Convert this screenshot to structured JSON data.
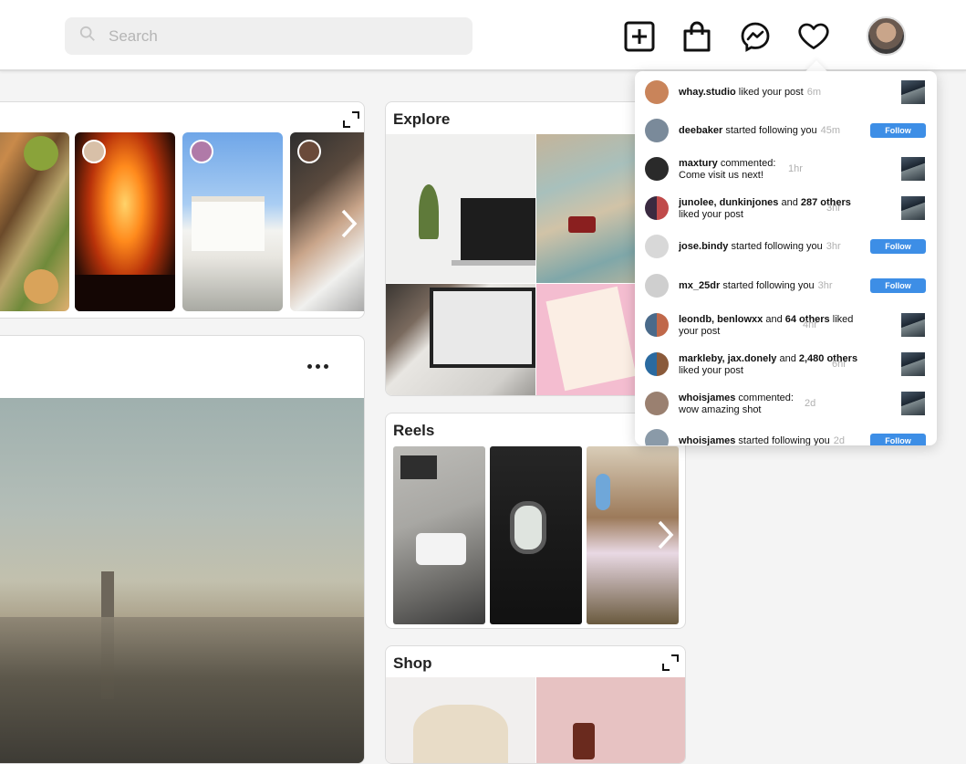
{
  "search": {
    "placeholder": "Search",
    "value": ""
  },
  "header": {
    "icons": [
      "new-post-icon",
      "shopping-bag-icon",
      "messenger-icon",
      "heart-icon"
    ]
  },
  "explore": {
    "title": "Explore"
  },
  "reels": {
    "title": "Reels"
  },
  "shop": {
    "title": "Shop"
  },
  "notifications": [
    {
      "user": "whay.studio",
      "action": " liked your post",
      "time": "6m",
      "kind": "thumb"
    },
    {
      "user": "deebaker",
      "action": " started following you",
      "time": "45m",
      "kind": "follow"
    },
    {
      "user": "maxtury",
      "action": " commented:",
      "line2": "Come visit us next!",
      "time": "1hr",
      "kind": "thumb"
    },
    {
      "user": "junolee, dunkinjones",
      "mid": " and ",
      "bold2": "287 others",
      "action": " liked your post",
      "time": "3hr",
      "kind": "thumb"
    },
    {
      "user": "jose.bindy",
      "action": " started following you",
      "time": "3hr",
      "kind": "follow"
    },
    {
      "user": "mx_25dr",
      "action": " started following you",
      "time": "3hr",
      "kind": "follow"
    },
    {
      "user": "leondb, benlowxx",
      "mid": " and ",
      "bold2": "64 others",
      "action": " liked your post",
      "time": "4hr",
      "kind": "thumb"
    },
    {
      "user": "markleby, jax.donely",
      "mid": " and ",
      "bold2": "2,480 others",
      "action": " liked your post",
      "time": "6hr",
      "kind": "thumb"
    },
    {
      "user": "whoisjames",
      "action": " commented:",
      "line2": "wow amazing shot",
      "time": "2d",
      "kind": "thumb"
    },
    {
      "user": "whoisjames",
      "action": " started following you",
      "time": "2d",
      "kind": "follow"
    }
  ],
  "follow_label": "Follow",
  "colors": {
    "accent": "#3d8ee6"
  }
}
